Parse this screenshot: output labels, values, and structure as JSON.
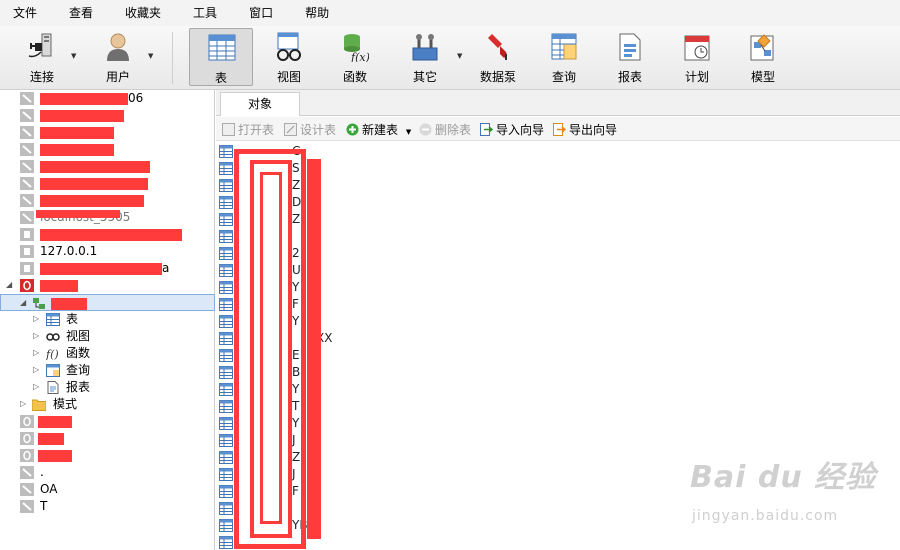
{
  "menu": [
    "文件",
    "查看",
    "收藏夹",
    "工具",
    "窗口",
    "帮助"
  ],
  "toolbar": {
    "tools": [
      {
        "label": "连接",
        "icon": "plug-icon"
      },
      {
        "label": "用户",
        "icon": "user-icon"
      },
      {
        "label": "表",
        "icon": "table-icon"
      },
      {
        "label": "视图",
        "icon": "view-glasses-icon"
      },
      {
        "label": "函数",
        "icon": "function-icon"
      },
      {
        "label": "其它",
        "icon": "tools-icon"
      },
      {
        "label": "数据泵",
        "icon": "data-pump-icon"
      },
      {
        "label": "查询",
        "icon": "query-icon"
      },
      {
        "label": "报表",
        "icon": "report-icon"
      },
      {
        "label": "计划",
        "icon": "calendar-icon"
      },
      {
        "label": "模型",
        "icon": "model-icon"
      }
    ]
  },
  "tree": {
    "items": [
      {
        "text": "06"
      },
      {
        "text": ""
      },
      {
        "text": ""
      },
      {
        "text": ""
      },
      {
        "text": ""
      },
      {
        "text": ""
      },
      {
        "text": ""
      },
      {
        "text": "localhost_5505"
      },
      {
        "text": ""
      },
      {
        "text": "127.0.0.1"
      },
      {
        "text": "a"
      },
      {
        "text": ""
      },
      {
        "text": ""
      },
      {
        "text": "表"
      },
      {
        "text": "视图"
      },
      {
        "text": "函数"
      },
      {
        "text": "查询"
      },
      {
        "text": "报表"
      },
      {
        "text": "模式"
      },
      {
        "text": ""
      },
      {
        "text": ""
      },
      {
        "text": ""
      },
      {
        "text": "."
      },
      {
        "text": "OA"
      },
      {
        "text": "T"
      }
    ]
  },
  "tabs": {
    "objects": "对象"
  },
  "subtoolbar": {
    "open_table": "打开表",
    "design_table": "设计表",
    "new_table": "新建表",
    "delete_table": "删除表",
    "import_wizard": "导入向导",
    "export_wizard": "导出向导"
  },
  "objects": [
    "C",
    "S",
    "Z",
    "D",
    "Z",
    "",
    "2",
    "U",
    "Y",
    "F",
    "Y",
    "XX",
    "E",
    "B",
    "Y",
    "T",
    "Y",
    "J",
    "Z",
    "J",
    "F",
    "",
    "YB",
    ""
  ],
  "watermark": {
    "title": "Bai du 经验",
    "sub": "jingyan.baidu.com"
  }
}
